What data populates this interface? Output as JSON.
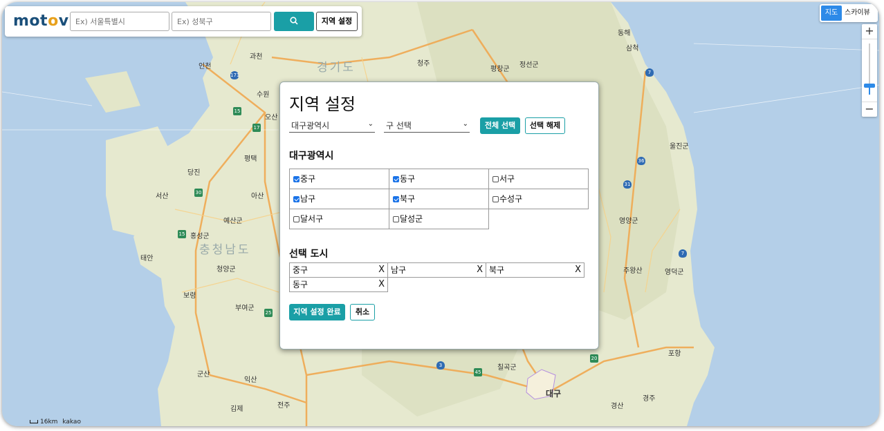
{
  "brand": {
    "logo_text_1": "mot",
    "logo_text_2": "o",
    "logo_text_3": "v"
  },
  "search": {
    "city_placeholder": "Ex) 서울특별시",
    "district_placeholder": "Ex) 성북구",
    "search_icon": "search-icon",
    "region_button": "지역 설정"
  },
  "map_controls": {
    "map_type_active": "지도",
    "map_type_other": "스카이뷰",
    "zoom_in": "+",
    "zoom_out": "−",
    "scale_text": "16km",
    "attribution": "kakao"
  },
  "map_labels": [
    {
      "text": "인천",
      "id": "incheon"
    },
    {
      "text": "경기도",
      "id": "gyeonggi"
    },
    {
      "text": "충청남도",
      "id": "chungnam"
    },
    {
      "text": "대구",
      "id": "daegu"
    },
    {
      "text": "동해",
      "id": "donghae"
    },
    {
      "text": "삼척",
      "id": "samcheok"
    },
    {
      "text": "포항",
      "id": "pohang"
    },
    {
      "text": "경주",
      "id": "gyeongju"
    },
    {
      "text": "과천",
      "id": "gwacheon"
    },
    {
      "text": "수원",
      "id": "suwon"
    },
    {
      "text": "오산",
      "id": "osan"
    },
    {
      "text": "평택",
      "id": "pyeongtaek"
    },
    {
      "text": "아산",
      "id": "asan"
    },
    {
      "text": "당진",
      "id": "dangjin"
    },
    {
      "text": "서산",
      "id": "seosan"
    },
    {
      "text": "홍성군",
      "id": "hongseong"
    },
    {
      "text": "보령",
      "id": "boryeong"
    },
    {
      "text": "군산",
      "id": "gunsan"
    },
    {
      "text": "익산",
      "id": "iksan"
    },
    {
      "text": "김제",
      "id": "gimje"
    },
    {
      "text": "전주",
      "id": "jeonju"
    },
    {
      "text": "영양군",
      "id": "yeongyang"
    },
    {
      "text": "울진군",
      "id": "uljin"
    },
    {
      "text": "평창군",
      "id": "pyeongchang"
    },
    {
      "text": "정선군",
      "id": "jeongseon"
    },
    {
      "text": "청주",
      "id": "cheongju"
    },
    {
      "text": "부여군",
      "id": "buyeo"
    },
    {
      "text": "태안",
      "id": "taean"
    },
    {
      "text": "예산군",
      "id": "yesan"
    },
    {
      "text": "청양군",
      "id": "cheongyang"
    },
    {
      "text": "주왕산",
      "id": "juwangsan"
    },
    {
      "text": "영덕군",
      "id": "yeongdeok"
    },
    {
      "text": "칠곡군",
      "id": "chilgok"
    },
    {
      "text": "경산",
      "id": "gyeongsan"
    }
  ],
  "modal": {
    "title": "지역 설정",
    "city_select": "대구광역시",
    "district_select": "구 선택",
    "select_all": "전체 선택",
    "deselect": "선택 해제",
    "city_heading": "대구광역시",
    "districts": [
      {
        "label": "중구",
        "checked": true
      },
      {
        "label": "동구",
        "checked": true
      },
      {
        "label": "서구",
        "checked": false
      },
      {
        "label": "남구",
        "checked": true
      },
      {
        "label": "북구",
        "checked": true
      },
      {
        "label": "수성구",
        "checked": false
      },
      {
        "label": "달서구",
        "checked": false
      },
      {
        "label": "달성군",
        "checked": false
      }
    ],
    "selected_heading": "선택 도시",
    "selected": [
      {
        "label": "중구",
        "remove": "X"
      },
      {
        "label": "남구",
        "remove": "X"
      },
      {
        "label": "북구",
        "remove": "X"
      },
      {
        "label": "동구",
        "remove": "X"
      }
    ],
    "confirm": "지역 설정 완료",
    "cancel": "취소"
  },
  "colors": {
    "accent": "#1a9fa6",
    "map_type_active": "#2d8ae8",
    "checkbox": "#1a73e8",
    "sea": "#b4cfe8",
    "land": "#e9ecd6"
  }
}
